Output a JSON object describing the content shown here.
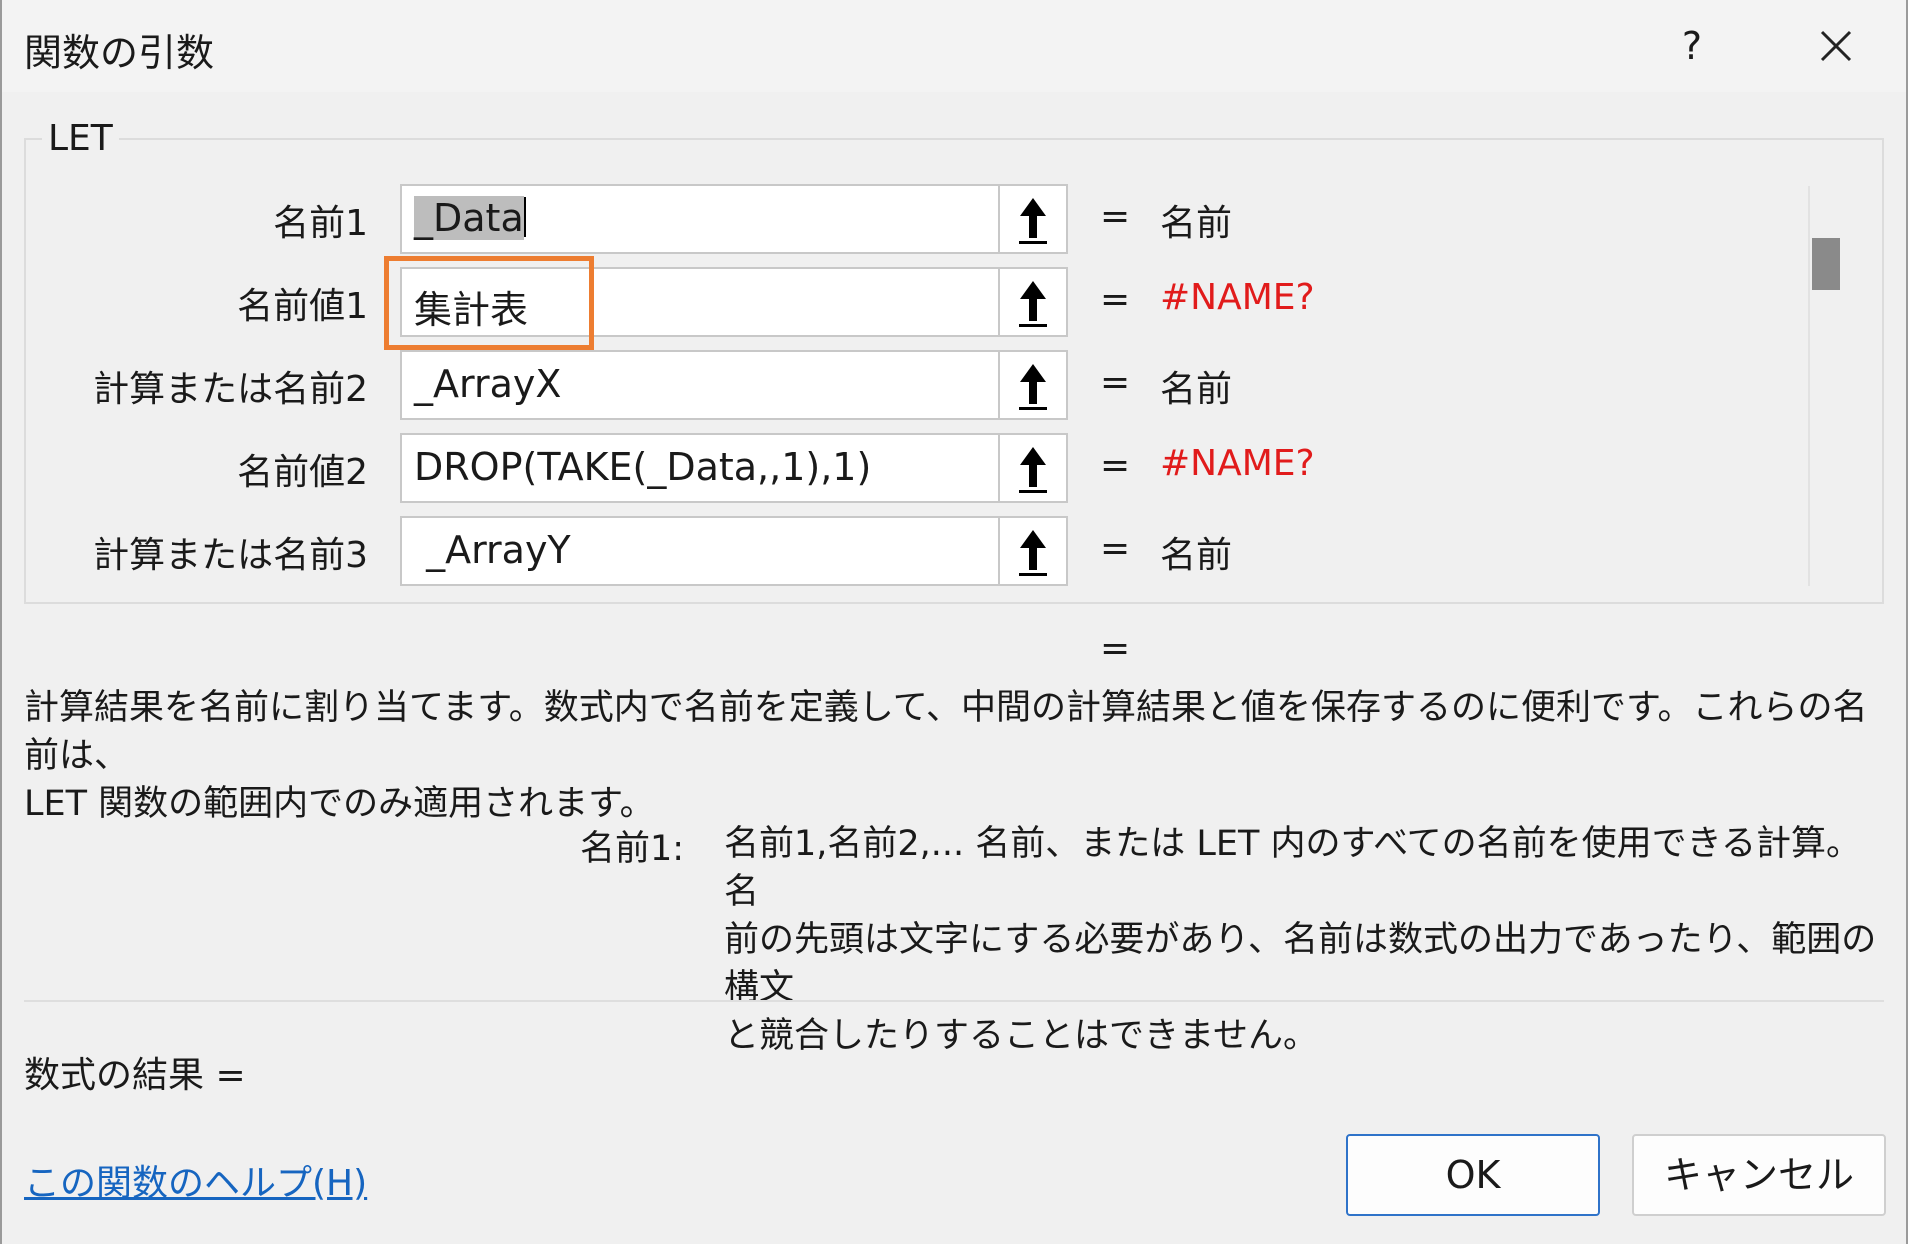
{
  "window": {
    "title": "関数の引数",
    "help_label": "?"
  },
  "group": {
    "label": "LET"
  },
  "args": [
    {
      "label": "名前1",
      "value": "_Data",
      "result": "名前"
    },
    {
      "label": "名前値1",
      "value": "集計表",
      "result": "#NAME?"
    },
    {
      "label": "計算または名前2",
      "value": "_ArrayX",
      "result": "名前"
    },
    {
      "label": "名前値2",
      "value": "DROP(TAKE(_Data,,1),1)",
      "result": "#NAME?"
    },
    {
      "label": "計算または名前3",
      "value": " _ArrayY",
      "result": "名前"
    }
  ],
  "equals": "=",
  "result_equals": "=",
  "description": {
    "line1": "計算結果を名前に割り当てます。数式内で名前を定義して、中間の計算結果と値を保存するのに便利です。これらの名前は、",
    "line2": "LET 関数の範囲内でのみ適用されます。"
  },
  "arg_description": {
    "name": "名前1:",
    "line1": "名前1,名前2,... 名前、または LET 内のすべての名前を使用できる計算。名",
    "line2": "前の先頭は文字にする必要があり、名前は数式の出力であったり、範囲の構文",
    "line3": "と競合したりすることはできません。"
  },
  "formula_result": "数式の結果 =",
  "help_link": "この関数のヘルプ(H)",
  "buttons": {
    "ok": "OK",
    "cancel": "キャンセル"
  },
  "colors": {
    "error": "#e11b1b",
    "highlight": "#ed7d31",
    "link": "#1665c0",
    "ok_border": "#2f73c9"
  },
  "icons": {
    "close": "close-icon",
    "ref": "arrow-up-icon"
  }
}
